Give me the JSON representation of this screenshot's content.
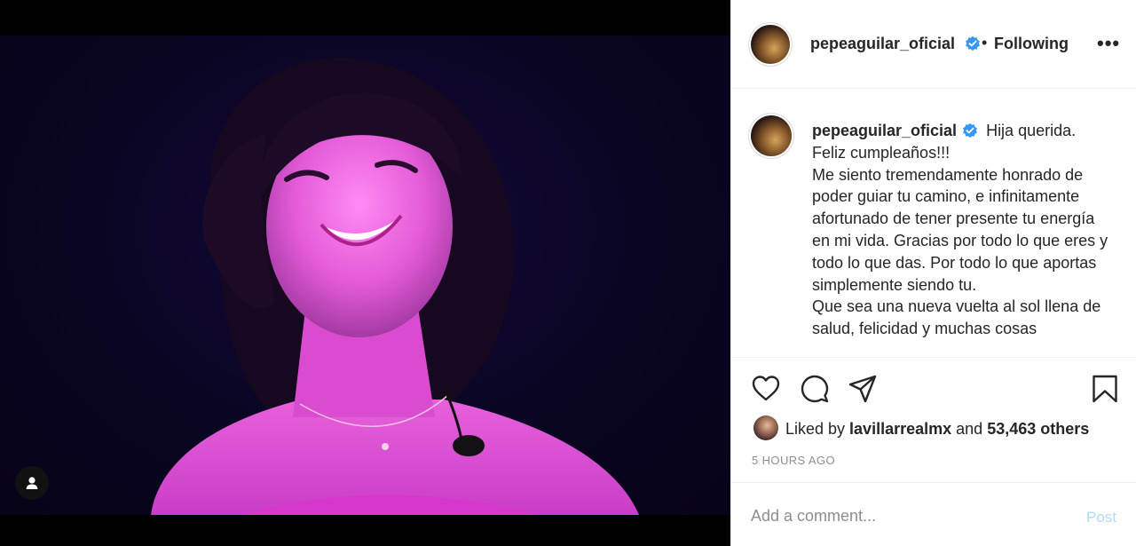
{
  "header": {
    "username": "pepeaguilar_oficial",
    "separator": "•",
    "following_label": "Following",
    "more_label": "•••"
  },
  "post": {
    "caption_username": "pepeaguilar_oficial",
    "caption_text": " Hija querida.\nFeliz cumpleaños!!!\nMe siento tremendamente honrado de poder guiar tu camino, e infinitamente afortunado de tener presente tu energía en mi vida. Gracias por todo lo que eres y todo lo que das. Por todo lo que aportas simplemente siendo tu.\nQue sea una nueva vuelta al sol llena de salud, felicidad y muchas cosas",
    "likes_prefix": "Liked by ",
    "liked_by_user": "lavillarrealmx",
    "likes_middle": " and ",
    "likes_count": "53,463 others",
    "timestamp": "5 HOURS AGO"
  },
  "comment": {
    "placeholder": "Add a comment...",
    "post_label": "Post"
  },
  "colors": {
    "verified": "#3897f0",
    "post_disabled": "#b3dbff",
    "text": "#262626",
    "muted": "#8e8e8e"
  },
  "icons": [
    "tag-user-icon",
    "verified-badge-icon",
    "heart-icon",
    "comment-icon",
    "share-icon",
    "bookmark-icon"
  ]
}
